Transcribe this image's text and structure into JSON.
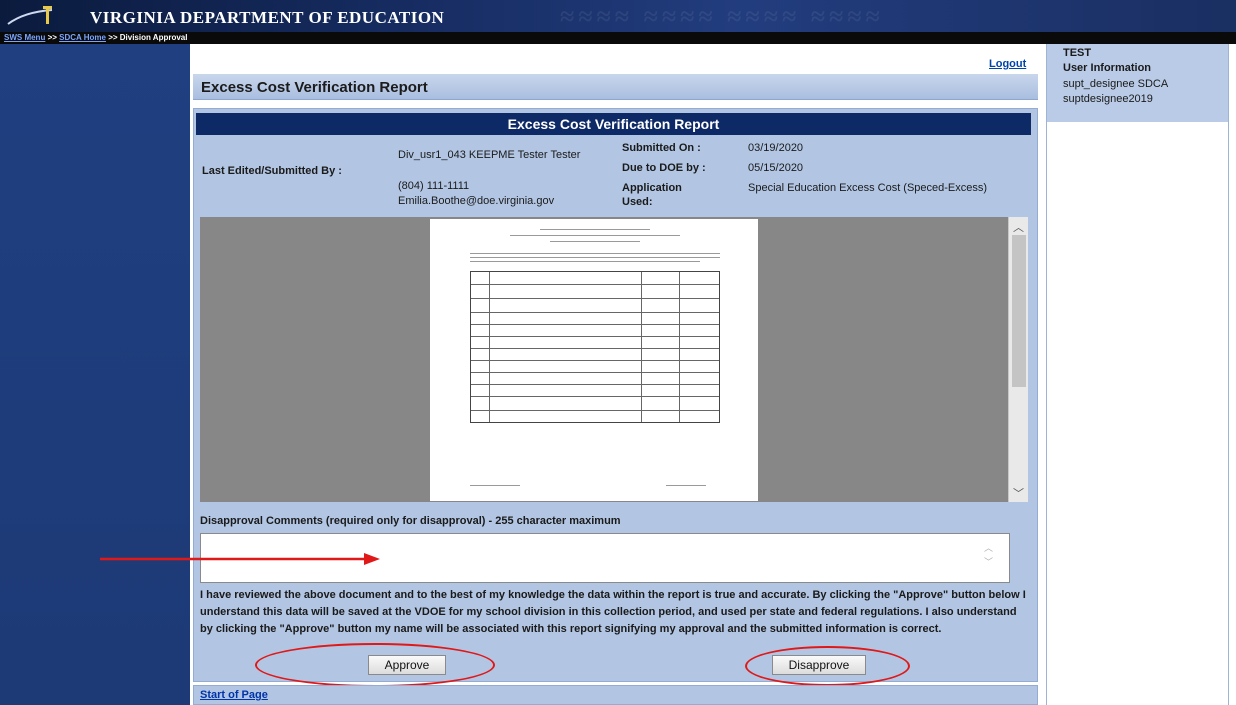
{
  "header": {
    "title": "VIRGINIA DEPARTMENT OF EDUCATION",
    "breadcrumb": {
      "sws_menu": "SWS Menu",
      "sep1": " >> ",
      "sdca_home": "SDCA Home",
      "current": " >> Division Approval"
    }
  },
  "logout_label": "Logout",
  "page_title": "Excess Cost Verification Report",
  "report": {
    "box_title": "Excess Cost Verification Report",
    "last_edited_label": "Last Edited/Submitted By :",
    "submitter_name": "Div_usr1_043 KEEPME Tester Tester",
    "submitter_phone": "(804) 111-1111",
    "submitter_email": "Emilia.Boothe@doe.virginia.gov",
    "submitted_on_label": "Submitted On :",
    "submitted_on": "03/19/2020",
    "due_label": "Due to DOE by :",
    "due_date": "05/15/2020",
    "application_label": "Application Used:",
    "application": "Special Education Excess Cost (Speced-Excess)"
  },
  "comments": {
    "label": "Disapproval Comments (required only for disapproval) - 255 character maximum",
    "value": ""
  },
  "statement": "I have reviewed the above document and to the best of my knowledge the data within the report is true and accurate. By clicking the \"Approve\" button below I understand this data will be saved at the VDOE for my school division in this collection period, and used per state and federal regulations. I also understand by clicking the \"Approve\" button my name will be associated with this report signifying my approval and the submitted information is correct.",
  "buttons": {
    "approve": "Approve",
    "disapprove": "Disapprove"
  },
  "start_of_page": "Start of Page",
  "user_panel": {
    "env": "TEST",
    "heading": "User Information",
    "role": "supt_designee SDCA",
    "username": "suptdesignee2019"
  },
  "colors": {
    "banner": "#172d63",
    "sidebar": "#1e3c7a",
    "panel": "#b2c6e4",
    "box_title": "#0e2a66",
    "annotation": "#e01818"
  }
}
